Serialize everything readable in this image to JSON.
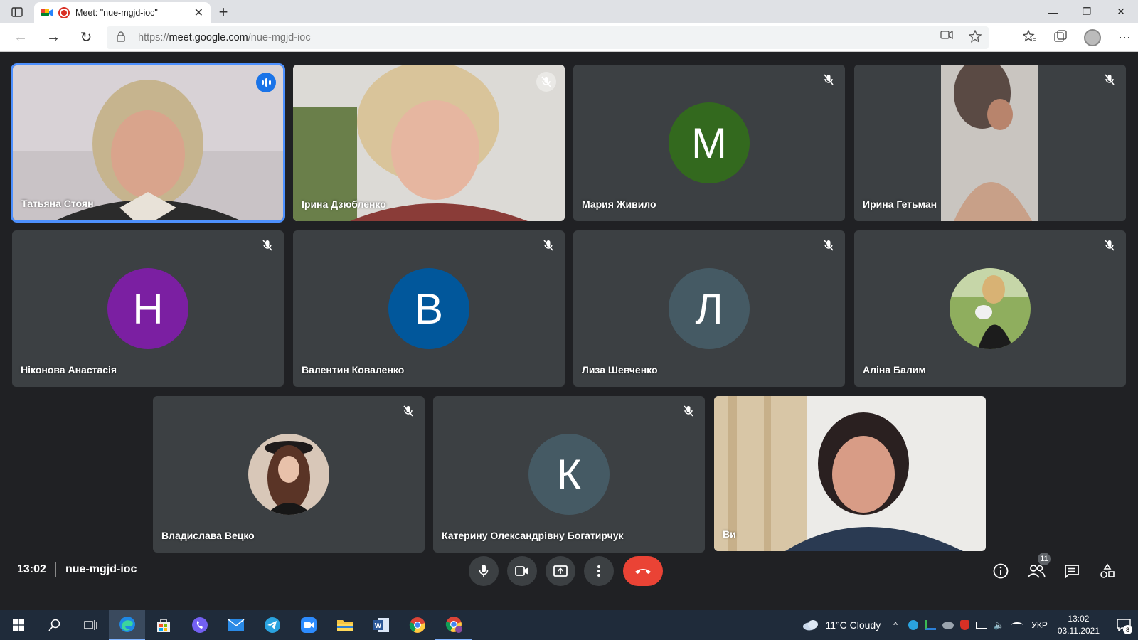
{
  "browser": {
    "tab_title": "Meet: \"nue-mgjd-ioc\"",
    "url_scheme": "https://",
    "url_host": "meet.google.com",
    "url_path": "/nue-mgjd-ioc"
  },
  "participants": [
    {
      "name": "Татьяна Стоян",
      "type": "video",
      "muted": false,
      "speaking": true
    },
    {
      "name": "Ірина Дзюбленко",
      "type": "video",
      "muted": true,
      "speaking": false
    },
    {
      "name": "Мария Живило",
      "type": "initial",
      "initial": "М",
      "color": "#33691e",
      "muted": true
    },
    {
      "name": "Ирина Гетьман",
      "type": "video",
      "muted": true
    },
    {
      "name": "Ніконова Анастасія",
      "type": "initial",
      "initial": "Н",
      "color": "#7b1fa2",
      "muted": true
    },
    {
      "name": "Валентин Коваленко",
      "type": "initial",
      "initial": "В",
      "color": "#01579b",
      "muted": true
    },
    {
      "name": "Лиза Шевченко",
      "type": "initial",
      "initial": "Л",
      "color": "#455a64",
      "muted": true
    },
    {
      "name": "Аліна Балим",
      "type": "photo",
      "muted": true
    },
    {
      "name": "Владислава Вецко",
      "type": "photo",
      "muted": true
    },
    {
      "name": "Катерину Олександрівну Богатирчук",
      "type": "initial",
      "initial": "К",
      "color": "#455a64",
      "muted": true
    },
    {
      "name": "Ви",
      "type": "video",
      "muted": false
    }
  ],
  "meeting": {
    "time": "13:02",
    "code": "nue-mgjd-ioc",
    "people_count": "11"
  },
  "taskbar": {
    "weather": "11°C  Cloudy",
    "lang": "УКР",
    "time": "13:02",
    "date": "03.11.2021",
    "notifications": "8"
  },
  "colors": {
    "meet_bg": "#202124",
    "tile_bg": "#3c4043",
    "end_call": "#ea4335",
    "speaker_outline": "#4d90fe"
  }
}
